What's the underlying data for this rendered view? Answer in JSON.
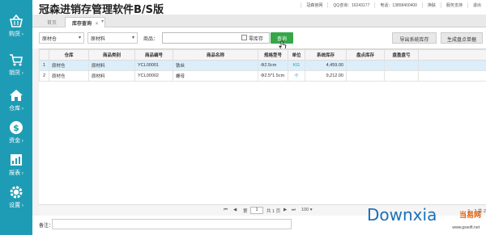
{
  "app": {
    "title": "冠森进销存管理软件B/S版"
  },
  "topbar": {
    "items": [
      "冠森官网",
      "QQ咨询：16243177",
      "电话：13858400400",
      "换肤",
      "服务支持",
      "退出"
    ]
  },
  "sidebar": {
    "items": [
      {
        "label": "购货",
        "icon": "basket-icon"
      },
      {
        "label": "销货",
        "icon": "cart-icon"
      },
      {
        "label": "仓库",
        "icon": "home-icon"
      },
      {
        "label": "资金",
        "icon": "dollar-icon"
      },
      {
        "label": "报表",
        "icon": "report-icon"
      },
      {
        "label": "设置",
        "icon": "gear-icon"
      }
    ]
  },
  "tabs": [
    {
      "label": "首页"
    },
    {
      "label": "库存查询",
      "closable": "×"
    }
  ],
  "tabs_more": "▾",
  "toolbar": {
    "warehouse": "原材仓",
    "category": "原材料",
    "goods_label": "商品：",
    "goods_value": "",
    "zero_stock_label": "零库存",
    "query_button": "查询",
    "export_button": "导出系统库存",
    "generate_button": "生成盘点单据"
  },
  "table": {
    "columns": [
      "",
      "仓库",
      "商品类别",
      "商品编号",
      "商品名称",
      "规格型号",
      "单位",
      "系统库存",
      "盘点库存",
      "盘盈盘亏"
    ],
    "rows": [
      [
        "1",
        "原材仓",
        "原材料",
        "YCL00001",
        "铁丝",
        "Φ2.5cm",
        "KG",
        "4,459.00",
        "",
        ""
      ],
      [
        "2",
        "原材仓",
        "原材料",
        "YCL00002",
        "螺母",
        "Φ2.5*1.5cm",
        "个",
        "9,212.00",
        "",
        ""
      ]
    ]
  },
  "pager": {
    "first": "⏮",
    "prev": "◀",
    "page_prefix": "第",
    "page_value": "1",
    "page_suffix": "共 1 页",
    "next": "▶",
    "last": "⏭",
    "page_size": "100 ▾",
    "range": "1 - 2 共 2"
  },
  "remark": {
    "label": "备注：",
    "value": ""
  },
  "watermark": {
    "brand": "Downxia",
    "cn": "当易网",
    "url": "www.gssoft.net"
  },
  "colors": {
    "sidebar": "#1f9cb5",
    "query_button": "#36a64a",
    "selected_row": "#dbeef9"
  }
}
